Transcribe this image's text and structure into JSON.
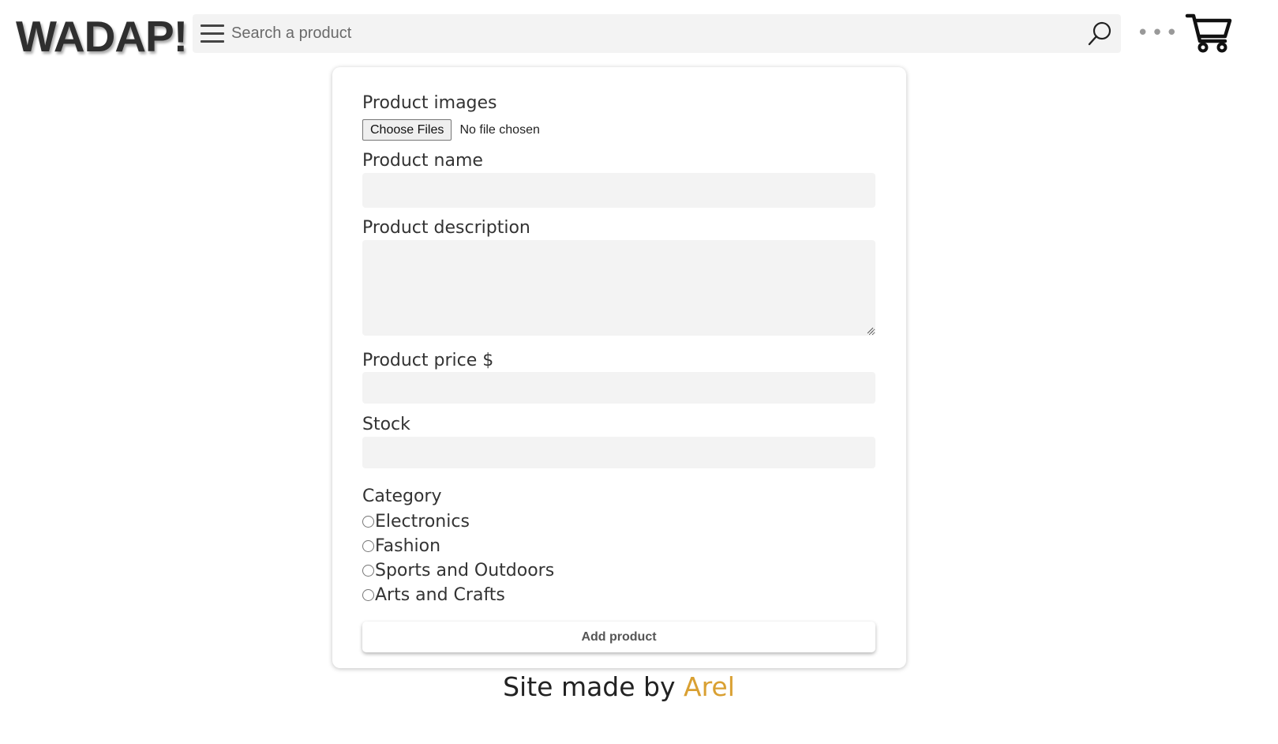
{
  "header": {
    "logo": "WADAP!",
    "search": {
      "placeholder": "Search a product",
      "value": ""
    },
    "more_label": "•••"
  },
  "form": {
    "images_label": "Product images",
    "file_button_label": "Choose Files",
    "file_status": "No file chosen",
    "name_label": "Product name",
    "description_label": "Product description",
    "price_label": "Product price $",
    "stock_label": "Stock",
    "category_label": "Category",
    "categories": [
      "Electronics",
      "Fashion",
      "Sports and Outdoors",
      "Arts and Crafts"
    ],
    "submit_label": "Add product"
  },
  "footer": {
    "text": "Site made by ",
    "author": "Arel"
  },
  "colors": {
    "accent": "#d9a032",
    "field_background": "#f3f3f3"
  },
  "icons": [
    "menu-icon",
    "search-icon",
    "more-icon",
    "cart-icon"
  ]
}
